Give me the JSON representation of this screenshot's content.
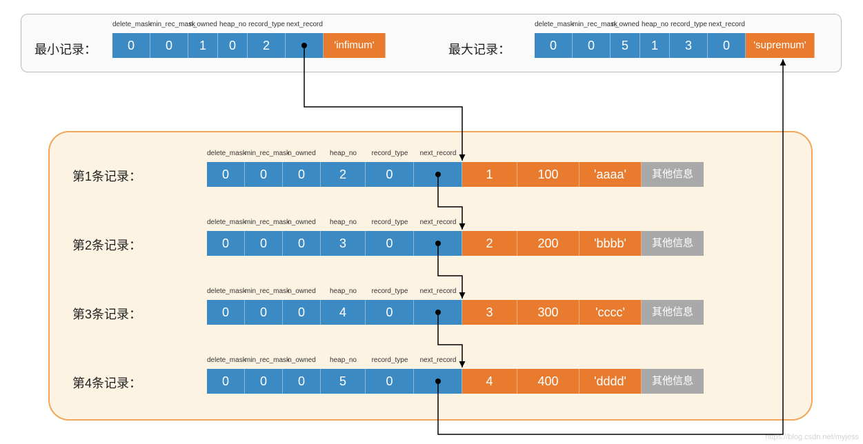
{
  "headers": [
    "delete_mask",
    "min_rec_mask",
    "n_owned",
    "heap_no",
    "record_type",
    "next_record"
  ],
  "top_min": {
    "label": "最小记录：",
    "cells": [
      "0",
      "0",
      "1",
      "0",
      "2",
      ""
    ],
    "tag": "'infimum'"
  },
  "top_max": {
    "label": "最大记录：",
    "cells": [
      "0",
      "0",
      "5",
      "1",
      "3",
      "0"
    ],
    "tag": "'supremum'"
  },
  "rows": [
    {
      "label": "第1条记录：",
      "cells": [
        "0",
        "0",
        "0",
        "2",
        "0",
        ""
      ],
      "data": [
        "1",
        "100",
        "'aaaa'"
      ],
      "extra": "其他信息"
    },
    {
      "label": "第2条记录：",
      "cells": [
        "0",
        "0",
        "0",
        "3",
        "0",
        ""
      ],
      "data": [
        "2",
        "200",
        "'bbbb'"
      ],
      "extra": "其他信息"
    },
    {
      "label": "第3条记录：",
      "cells": [
        "0",
        "0",
        "0",
        "4",
        "0",
        ""
      ],
      "data": [
        "3",
        "300",
        "'cccc'"
      ],
      "extra": "其他信息"
    },
    {
      "label": "第4条记录：",
      "cells": [
        "0",
        "0",
        "0",
        "5",
        "0",
        ""
      ],
      "data": [
        "4",
        "400",
        "'dddd'"
      ],
      "extra": "其他信息"
    }
  ],
  "watermark": "https://blog.csdn.net/myjess"
}
